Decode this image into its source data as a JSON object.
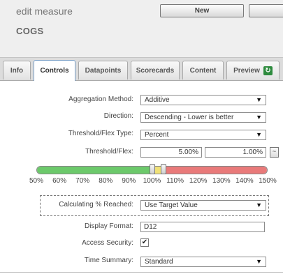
{
  "header": {
    "page_title": "edit measure",
    "measure_name": "COGS",
    "new_button": "New"
  },
  "tabs": [
    {
      "label": "Info"
    },
    {
      "label": "Controls",
      "active": true
    },
    {
      "label": "Datapoints"
    },
    {
      "label": "Scorecards"
    },
    {
      "label": "Content"
    },
    {
      "label": "Preview"
    }
  ],
  "form": {
    "aggregation": {
      "label": "Aggregation Method:",
      "value": "Additive"
    },
    "direction": {
      "label": "Direction:",
      "value": "Descending - Lower is better"
    },
    "threshold_type": {
      "label": "Threshold/Flex Type:",
      "value": "Percent"
    },
    "threshold_flex": {
      "label": "Threshold/Flex:",
      "threshold": "5.00%",
      "flex": "1.00%",
      "button": "~"
    },
    "calc_reached": {
      "label": "Calculating % Reached:",
      "value": "Use Target Value"
    },
    "display_format": {
      "label": "Display Format:",
      "value": "D12"
    },
    "access_security": {
      "label": "Access Security:",
      "checked": true
    },
    "time_summary": {
      "label": "Time Summary:",
      "value": "Standard"
    }
  },
  "slider": {
    "min": 50,
    "max": 150,
    "tick_labels": [
      "50%",
      "60%",
      "70%",
      "80%",
      "90%",
      "100%",
      "110%",
      "120%",
      "130%",
      "140%",
      "150%"
    ],
    "green_end": 100,
    "yellow_end": 105,
    "handle_values": [
      100,
      105
    ],
    "colors": {
      "green": "#6cc96b",
      "yellow": "#f0e177",
      "red": "#e97a7a"
    }
  },
  "icons": {
    "refresh": "refresh-icon",
    "dropdown": "chevron-down-icon"
  }
}
